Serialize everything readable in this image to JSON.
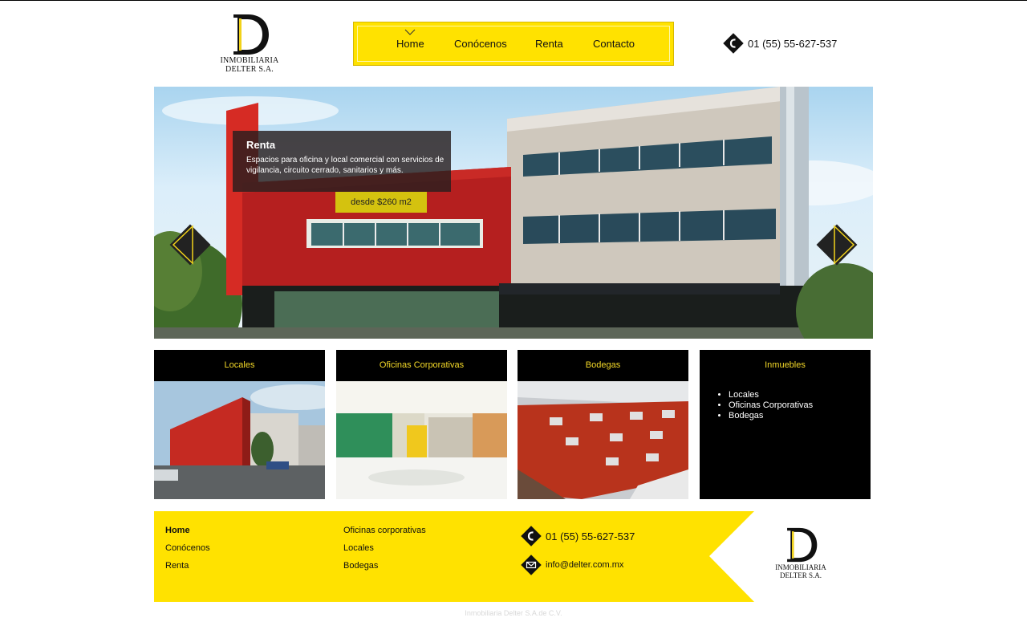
{
  "brand": {
    "logo_letter": "D",
    "line1": "INMOBILIARIA",
    "line2": "DELTER S.A."
  },
  "nav": {
    "items": [
      "Home",
      "Conócenos",
      "Renta",
      "Contacto"
    ],
    "active": "Home"
  },
  "phone": "01 (55) 55-627-537",
  "hero": {
    "title": "Renta",
    "description": "Espacios para oficina y local comercial con servicios de vigilancia, circuito cerrado, sanitarios y más.",
    "price": "desde $260  m2"
  },
  "cards": [
    {
      "title": "Locales"
    },
    {
      "title": "Oficinas Corporativas"
    },
    {
      "title": "Bodegas"
    },
    {
      "title": "Inmuebles",
      "list": [
        "Locales",
        "Oficinas Corporativas",
        "Bodegas"
      ]
    }
  ],
  "footer": {
    "col1": [
      "Home",
      "Conócenos",
      "Renta"
    ],
    "col2": [
      "Oficinas corporativas",
      "Locales",
      "Bodegas"
    ],
    "phone": "01 (55) 55-627-537",
    "email": "info@delter.com.mx"
  },
  "copyright": "Inmobiliaria Delter S.A.de C.V.",
  "colors": {
    "accent": "#ffe200",
    "gold_text": "#f4d928",
    "dark": "#000000"
  },
  "icons": [
    "phone-icon",
    "mail-icon",
    "prev-arrow-icon",
    "next-arrow-icon",
    "caret-down-icon"
  ]
}
